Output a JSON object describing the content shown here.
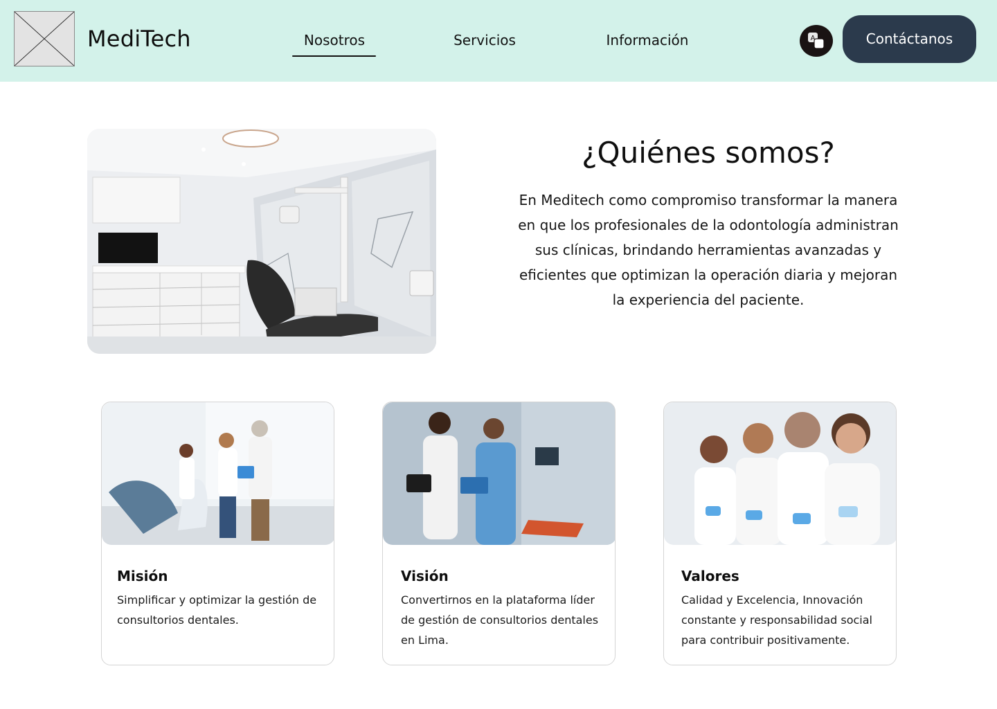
{
  "header": {
    "brand": "MediTech",
    "nav": [
      {
        "label": "Nosotros",
        "active": true
      },
      {
        "label": "Servicios",
        "active": false
      },
      {
        "label": "Información",
        "active": false
      }
    ],
    "language_icon": "translate-icon",
    "contact_label": "Contáctanos"
  },
  "about": {
    "title": "¿Quiénes somos?",
    "text": "En Meditech como compromiso transformar la manera en que los profesionales de la odontología administran sus clínicas, brindando herramientas avanzadas y eficientes que optimizan la operación diaria y mejoran la experiencia del paciente."
  },
  "cards": [
    {
      "title": "Misión",
      "text": "Simplificar y optimizar la gestión de consultorios dentales."
    },
    {
      "title": "Visión",
      "text": "Convertirnos en la plataforma líder de gestión de consultorios dentales en Lima."
    },
    {
      "title": "Valores",
      "text": "Calidad y Excelencia, Innovación constante y responsabilidad social para contribuir positivamente."
    }
  ],
  "colors": {
    "header_bg": "#d3f2ea",
    "contact_button_bg": "#2b3a4c",
    "language_button_bg": "#1a1313"
  }
}
